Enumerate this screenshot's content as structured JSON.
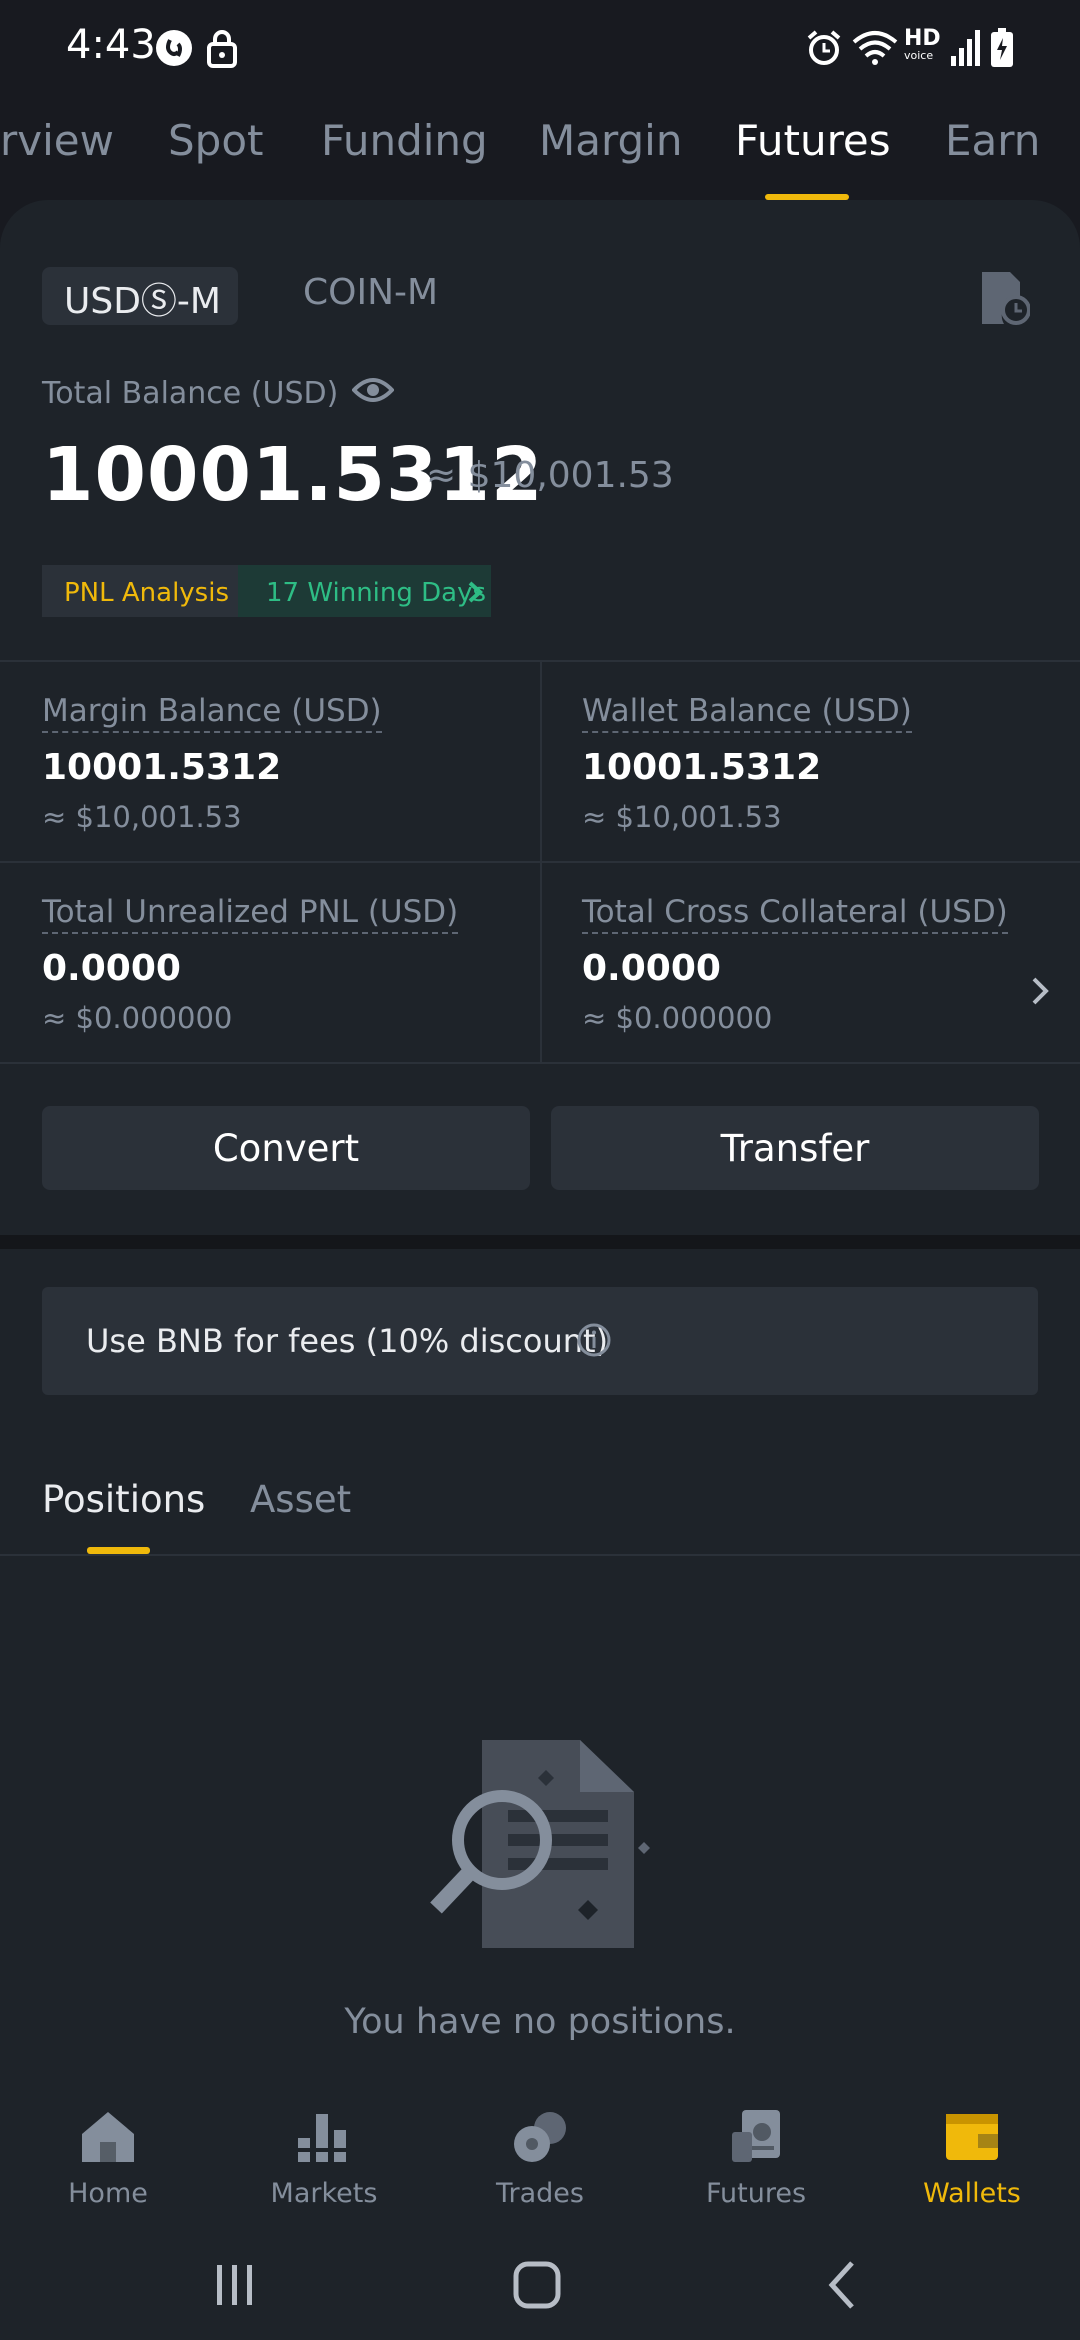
{
  "status_bar": {
    "time": "4:43",
    "left_icons": [
      "shazam-icon",
      "lock-icon"
    ],
    "right_icons": [
      "alarm-icon",
      "wifi-icon",
      "hd-voice-icon",
      "signal-icon",
      "battery-charging-icon"
    ],
    "hd_text": "HD",
    "voice_text": "voice"
  },
  "top_tabs": {
    "items": [
      "rview",
      "Spot",
      "Funding",
      "Margin",
      "Futures",
      "Earn"
    ],
    "active": "Futures"
  },
  "futures": {
    "segment_active": "USDⓈ-M",
    "segment_other": "COIN-M",
    "total_balance_label": "Total Balance (USD)",
    "total_balance_value": "10001.5312",
    "total_balance_approx": "≈ $10,001.53",
    "pnl_analysis_label": "PNL Analysis",
    "winning_days_label": "17 Winning Days",
    "stats": {
      "margin_balance": {
        "label": "Margin Balance (USD)",
        "value": "10001.5312",
        "approx": "≈ $10,001.53"
      },
      "wallet_balance": {
        "label": "Wallet Balance (USD)",
        "value": "10001.5312",
        "approx": "≈ $10,001.53"
      },
      "unrealized_pnl": {
        "label": "Total Unrealized PNL (USD)",
        "value": "0.0000",
        "approx": "≈ $0.000000"
      },
      "cross_collateral": {
        "label": "Total Cross Collateral (USD)",
        "value": "0.0000",
        "approx": "≈ $0.000000"
      }
    },
    "convert_label": "Convert",
    "transfer_label": "Transfer",
    "bnb_fee_label": "Use BNB for fees (10% discount)"
  },
  "sub_tabs": {
    "items": [
      "Positions",
      "Asset"
    ],
    "active": "Positions"
  },
  "empty_state": {
    "text": "You have no positions."
  },
  "bottom_nav": {
    "items": [
      "Home",
      "Markets",
      "Trades",
      "Futures",
      "Wallets"
    ],
    "active": "Wallets"
  },
  "colors": {
    "accent": "#f0b90b",
    "positive": "#2ebd85",
    "background": "#181a20",
    "card": "#1e2329"
  }
}
